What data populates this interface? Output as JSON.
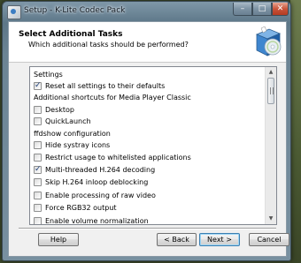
{
  "window": {
    "title": "Setup - K-Lite Codec Pack",
    "minimize_glyph": "–",
    "maximize_glyph": "□",
    "close_glyph": "✕"
  },
  "header": {
    "title": "Select Additional Tasks",
    "subtitle": "Which additional tasks should be performed?",
    "icon": "setup-box-cd-icon"
  },
  "tasks": {
    "items": [
      {
        "type": "group",
        "label": "Settings"
      },
      {
        "type": "check",
        "label": "Reset all settings to their defaults",
        "checked": true
      },
      {
        "type": "group",
        "label": "Additional shortcuts for Media Player Classic"
      },
      {
        "type": "check",
        "label": "Desktop",
        "checked": false
      },
      {
        "type": "check",
        "label": "QuickLaunch",
        "checked": false
      },
      {
        "type": "group",
        "label": "ffdshow configuration"
      },
      {
        "type": "check",
        "label": "Hide systray icons",
        "checked": false
      },
      {
        "type": "check",
        "label": "Restrict usage to whitelisted applications",
        "checked": false
      },
      {
        "type": "check",
        "label": "Multi-threaded H.264 decoding",
        "checked": true
      },
      {
        "type": "check",
        "label": "Skip H.264 inloop deblocking",
        "checked": false
      },
      {
        "type": "check",
        "label": "Enable processing of raw video",
        "checked": false
      },
      {
        "type": "check",
        "label": "Force RGB32 output",
        "checked": false
      },
      {
        "type": "check",
        "label": "Enable volume normalization",
        "checked": false
      }
    ]
  },
  "buttons": {
    "help": "Help",
    "back": "< Back",
    "next": "Next >",
    "cancel": "Cancel"
  },
  "scrollbar": {
    "up_glyph": "▲",
    "down_glyph": "▼"
  }
}
